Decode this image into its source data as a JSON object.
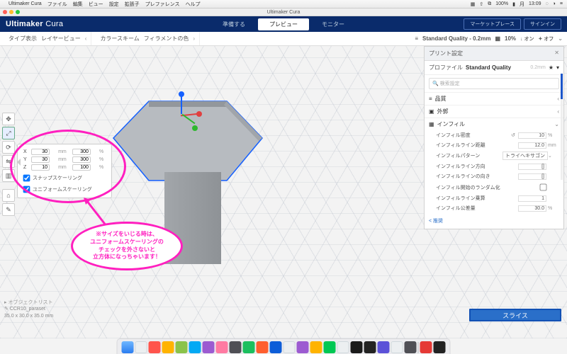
{
  "menubar": {
    "app": "Ultimaker Cura",
    "items": [
      "ファイル",
      "編集",
      "ビュー",
      "設定",
      "拡張子",
      "プレファレンス",
      "ヘルプ"
    ],
    "right": {
      "battery": "100%",
      "day": "月",
      "time": "13:09"
    }
  },
  "window": {
    "title": "Ultimaker Cura"
  },
  "cura": {
    "brand_a": "Ultimaker",
    "brand_b": "Cura",
    "stages": {
      "prepare": "準備する",
      "preview": "プレビュー",
      "monitor": "モニター"
    },
    "marketplace": "マーケットプレース",
    "signin": "サインイン"
  },
  "subhead": {
    "type_label": "タイプ表示",
    "layerview": "レイヤービュー",
    "colorscheme": "カラースキーム",
    "filament_color": "フィラメントの色",
    "quality": "Standard Quality - 0.2mm",
    "infill_pct": "10%",
    "on": "オン",
    "off": "オフ"
  },
  "ltools": [
    "move",
    "scale",
    "rotate",
    "mirror",
    "mesh",
    "support",
    "custom"
  ],
  "scale": {
    "axes": [
      {
        "axis": "X",
        "mm": "30",
        "pct": "300"
      },
      {
        "axis": "Y",
        "mm": "30",
        "pct": "300"
      },
      {
        "axis": "Z",
        "mm": "10",
        "pct": "100"
      }
    ],
    "unit_mm": "mm",
    "unit_pct": "%",
    "snap": "スナップスケーリング",
    "uniform": "ユニフォームスケーリング"
  },
  "annotation": {
    "text": "※サイズをいじる時は、\nユニフォームスケーリングの\nチェックを外さないと\n立方体になっちゃいます！"
  },
  "settings": {
    "panel_title": "プリント設定",
    "profile_label": "プロファイル",
    "profile_value": "Standard Quality",
    "profile_dim": "0.2mm",
    "search_placeholder": "検索設定",
    "cats": {
      "quality": "品質",
      "shell": "外郭",
      "infill": "インフィル"
    },
    "rows": {
      "infill_density": {
        "k": "インフィル密度",
        "v": "10",
        "u": "%"
      },
      "infill_line_dist": {
        "k": "インフィルライン距離",
        "v": "12.0",
        "u": "mm"
      },
      "infill_pattern": {
        "k": "インフィルパターン",
        "v": "トライヘキサゴン"
      },
      "infill_line_dir": {
        "k": "インフィルライン方向",
        "v": "[]"
      },
      "infill_line_size": {
        "k": "インフィルラインの向き",
        "v": "[]"
      },
      "infill_random_start": {
        "k": "インフィル開始のランダム化",
        "v": ""
      },
      "infill_line_mult": {
        "k": "インフィルライン乗算",
        "v": "1"
      },
      "infill_sparse": {
        "k": "インフィル公差量",
        "v": "30.0",
        "u": "%"
      }
    },
    "recommend": "< 推奨"
  },
  "objinfo": {
    "list": "オブジェクトリスト",
    "name": "CCR10_paraset",
    "dims": "35.0 x 30.0 x 35.0 mm"
  },
  "slice": "スライス"
}
